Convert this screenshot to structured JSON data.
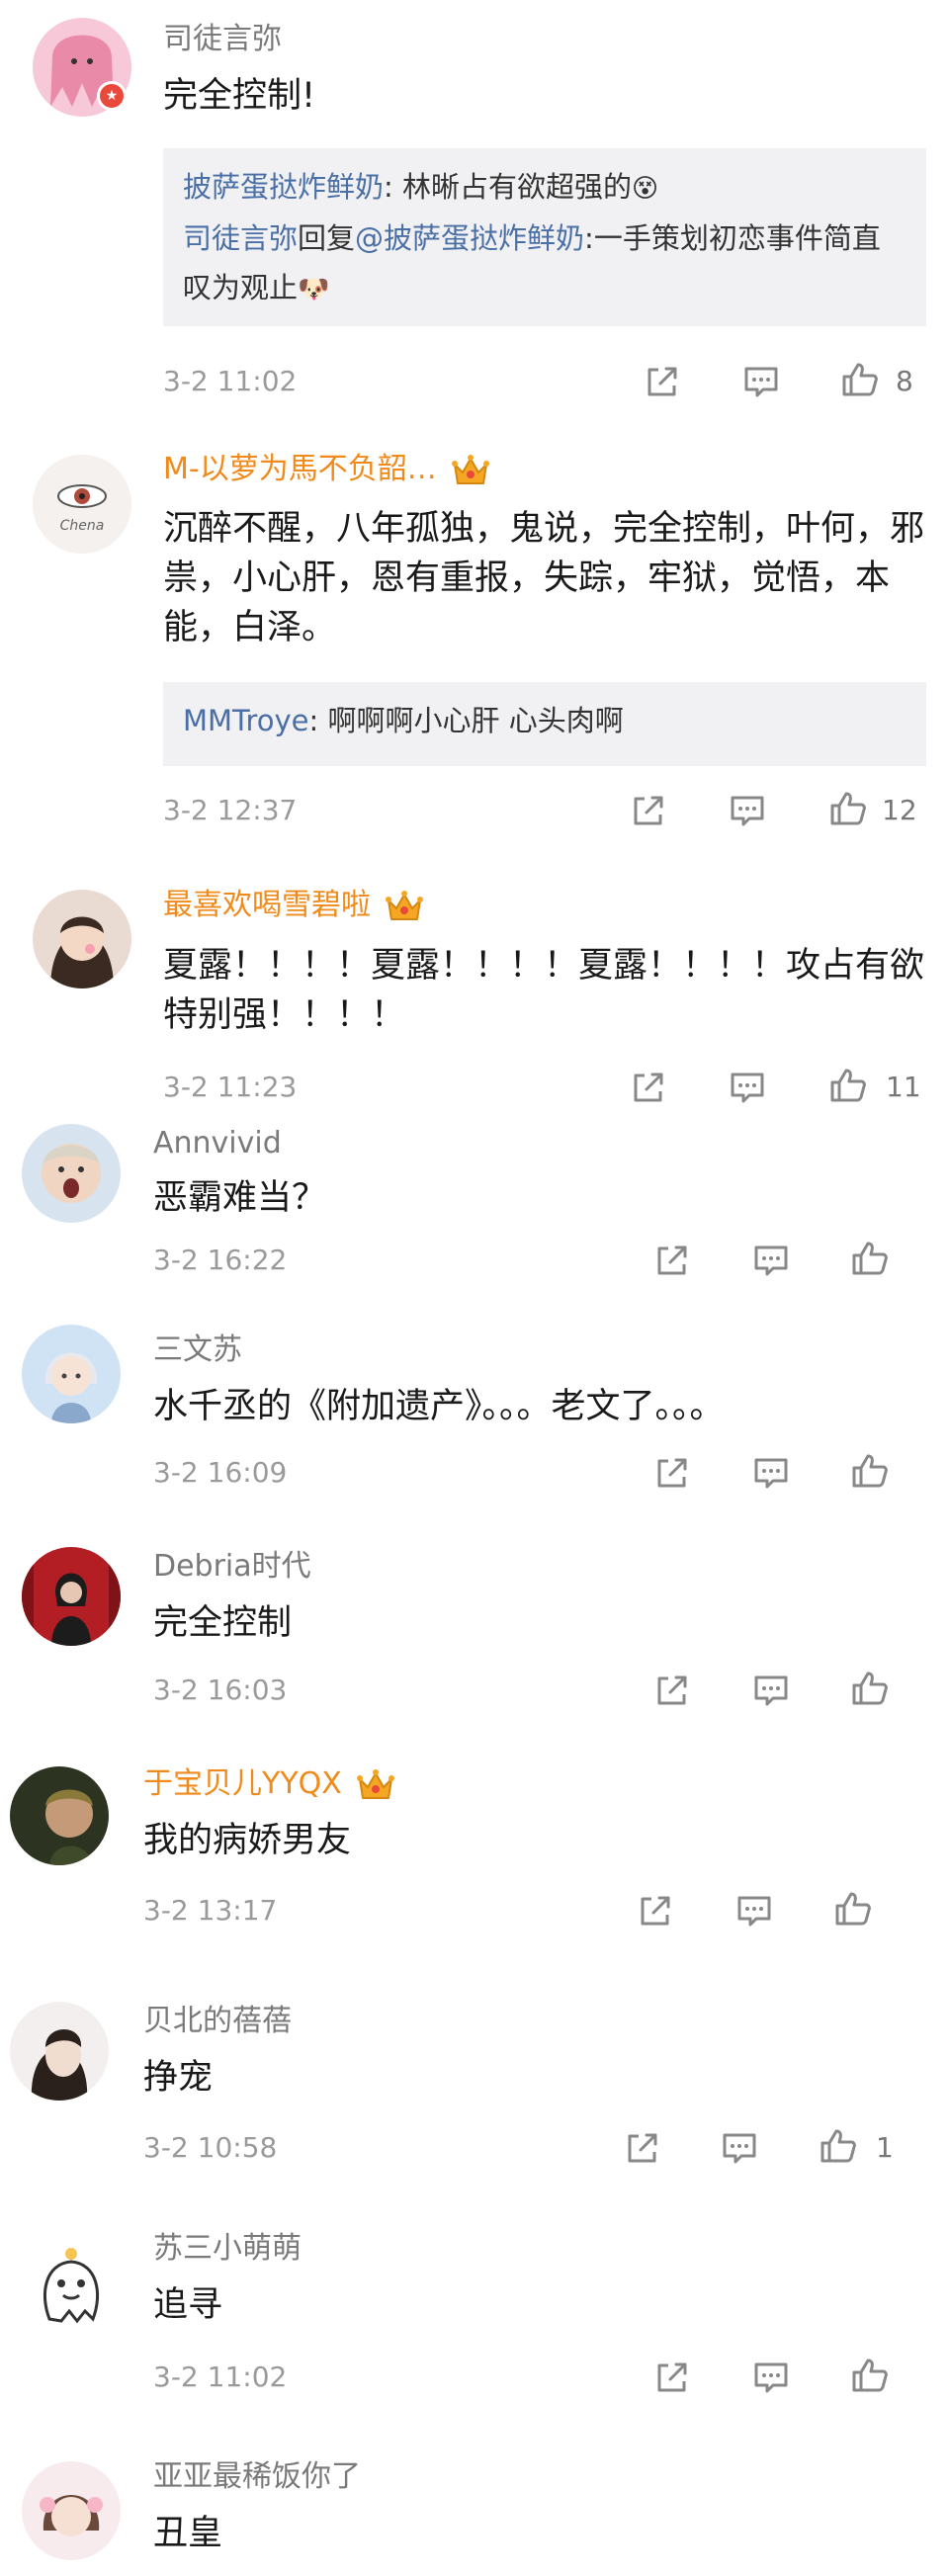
{
  "comments": [
    {
      "username": "司徒言弥",
      "vip": false,
      "text": "完全控制!",
      "replies": [
        {
          "user": "披萨蛋挞炸鲜奶",
          "sep": ": ",
          "text": "林晰占有欲超强的",
          "emoji": "😵"
        },
        {
          "user": "司徒言弥",
          "mid": "回复",
          "to": "@披萨蛋挞炸鲜奶",
          "sep": ":",
          "text": "一手策划初恋事件简直叹为观止",
          "emoji": "🐶"
        }
      ],
      "time": "3-2 11:02",
      "likes": "8"
    },
    {
      "username": "M-以萝为馬不负韶…",
      "vip": true,
      "text": "沉醉不醒，八年孤独，鬼说，完全控制，叶何，邪祟，小心肝，恩有重报，失踪，牢狱，觉悟，本能，白泽。",
      "replies": [
        {
          "user": "MMTroye",
          "sep": ": ",
          "text": "啊啊啊小心肝 心头肉啊"
        }
      ],
      "time": "3-2 12:37",
      "likes": "12"
    },
    {
      "username": "最喜欢喝雪碧啦",
      "vip": true,
      "text": "夏露！！！！夏露！！！！夏露！！！！攻占有欲特别强！！！！",
      "time": "3-2 11:23",
      "likes": "11"
    },
    {
      "username": "Annvivid",
      "vip": false,
      "text": "恶霸难当？",
      "time": "3-2 16:22",
      "likes": ""
    },
    {
      "username": "三文苏",
      "vip": false,
      "text": "水千丞的《附加遗产》。。。老文了。。。",
      "time": "3-2 16:09",
      "likes": ""
    },
    {
      "username": "Debria时代",
      "vip": false,
      "text": "完全控制",
      "time": "3-2 16:03",
      "likes": ""
    },
    {
      "username": "于宝贝儿YYQX",
      "vip": true,
      "text": "我的病娇男友",
      "time": "3-2 13:17",
      "likes": ""
    },
    {
      "username": "贝北的蓓蓓",
      "vip": false,
      "text": "挣宠",
      "time": "3-2 10:58",
      "likes": "1"
    },
    {
      "username": "苏三小萌萌",
      "vip": false,
      "text": "追寻",
      "time": "3-2 11:02",
      "likes": ""
    },
    {
      "username": "亚亚最稀饭你了",
      "vip": false,
      "text": "丑皇",
      "time": "",
      "likes": ""
    }
  ],
  "colors": {
    "vip_name": "#f08a1a",
    "link": "#4a6fa5",
    "reply_bg": "#f1f1f3",
    "crown": "#f5a623",
    "badge": "#e8493a"
  },
  "icons": {
    "share": "share-icon",
    "comment": "comment-icon",
    "like": "thumbs-up-icon",
    "crown": "crown-icon"
  }
}
